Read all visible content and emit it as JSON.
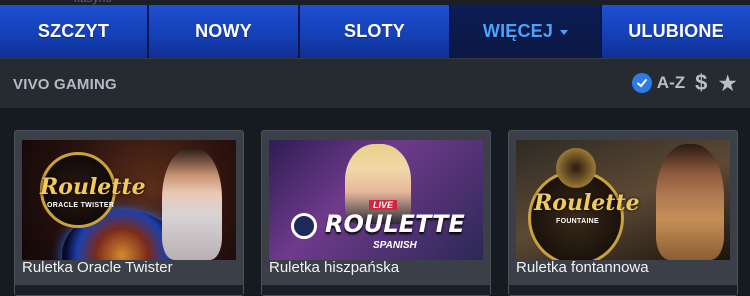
{
  "top_text": "kasyno",
  "nav": {
    "tabs": [
      {
        "label": "SZCZYT",
        "active": false
      },
      {
        "label": "NOWY",
        "active": false
      },
      {
        "label": "SLOTY",
        "active": false
      },
      {
        "label": "WIĘCEJ",
        "active": true
      },
      {
        "label": "ULUBIONE",
        "active": false
      }
    ]
  },
  "section": {
    "title": "VIVO GAMING",
    "sort_label": "A-Z",
    "price_symbol": "$",
    "favorite_symbol": "★"
  },
  "games": [
    {
      "name": "Ruletka Oracle Twister",
      "logo_main": "Roulette",
      "logo_sub": "ORACLE TWISTER"
    },
    {
      "name": "Ruletka hiszpańska",
      "logo_top": "LIVE",
      "logo_main": "ROULETTE",
      "logo_sub": "SPANISH"
    },
    {
      "name": "Ruletka fontannowa",
      "logo_main": "Roulette",
      "logo_sub": "FOUNTAINE"
    }
  ],
  "colors": {
    "accent": "#4aa3ff",
    "nav_blue": "#1541b8",
    "nav_active": "#0d1d55",
    "check": "#2e7be8"
  }
}
